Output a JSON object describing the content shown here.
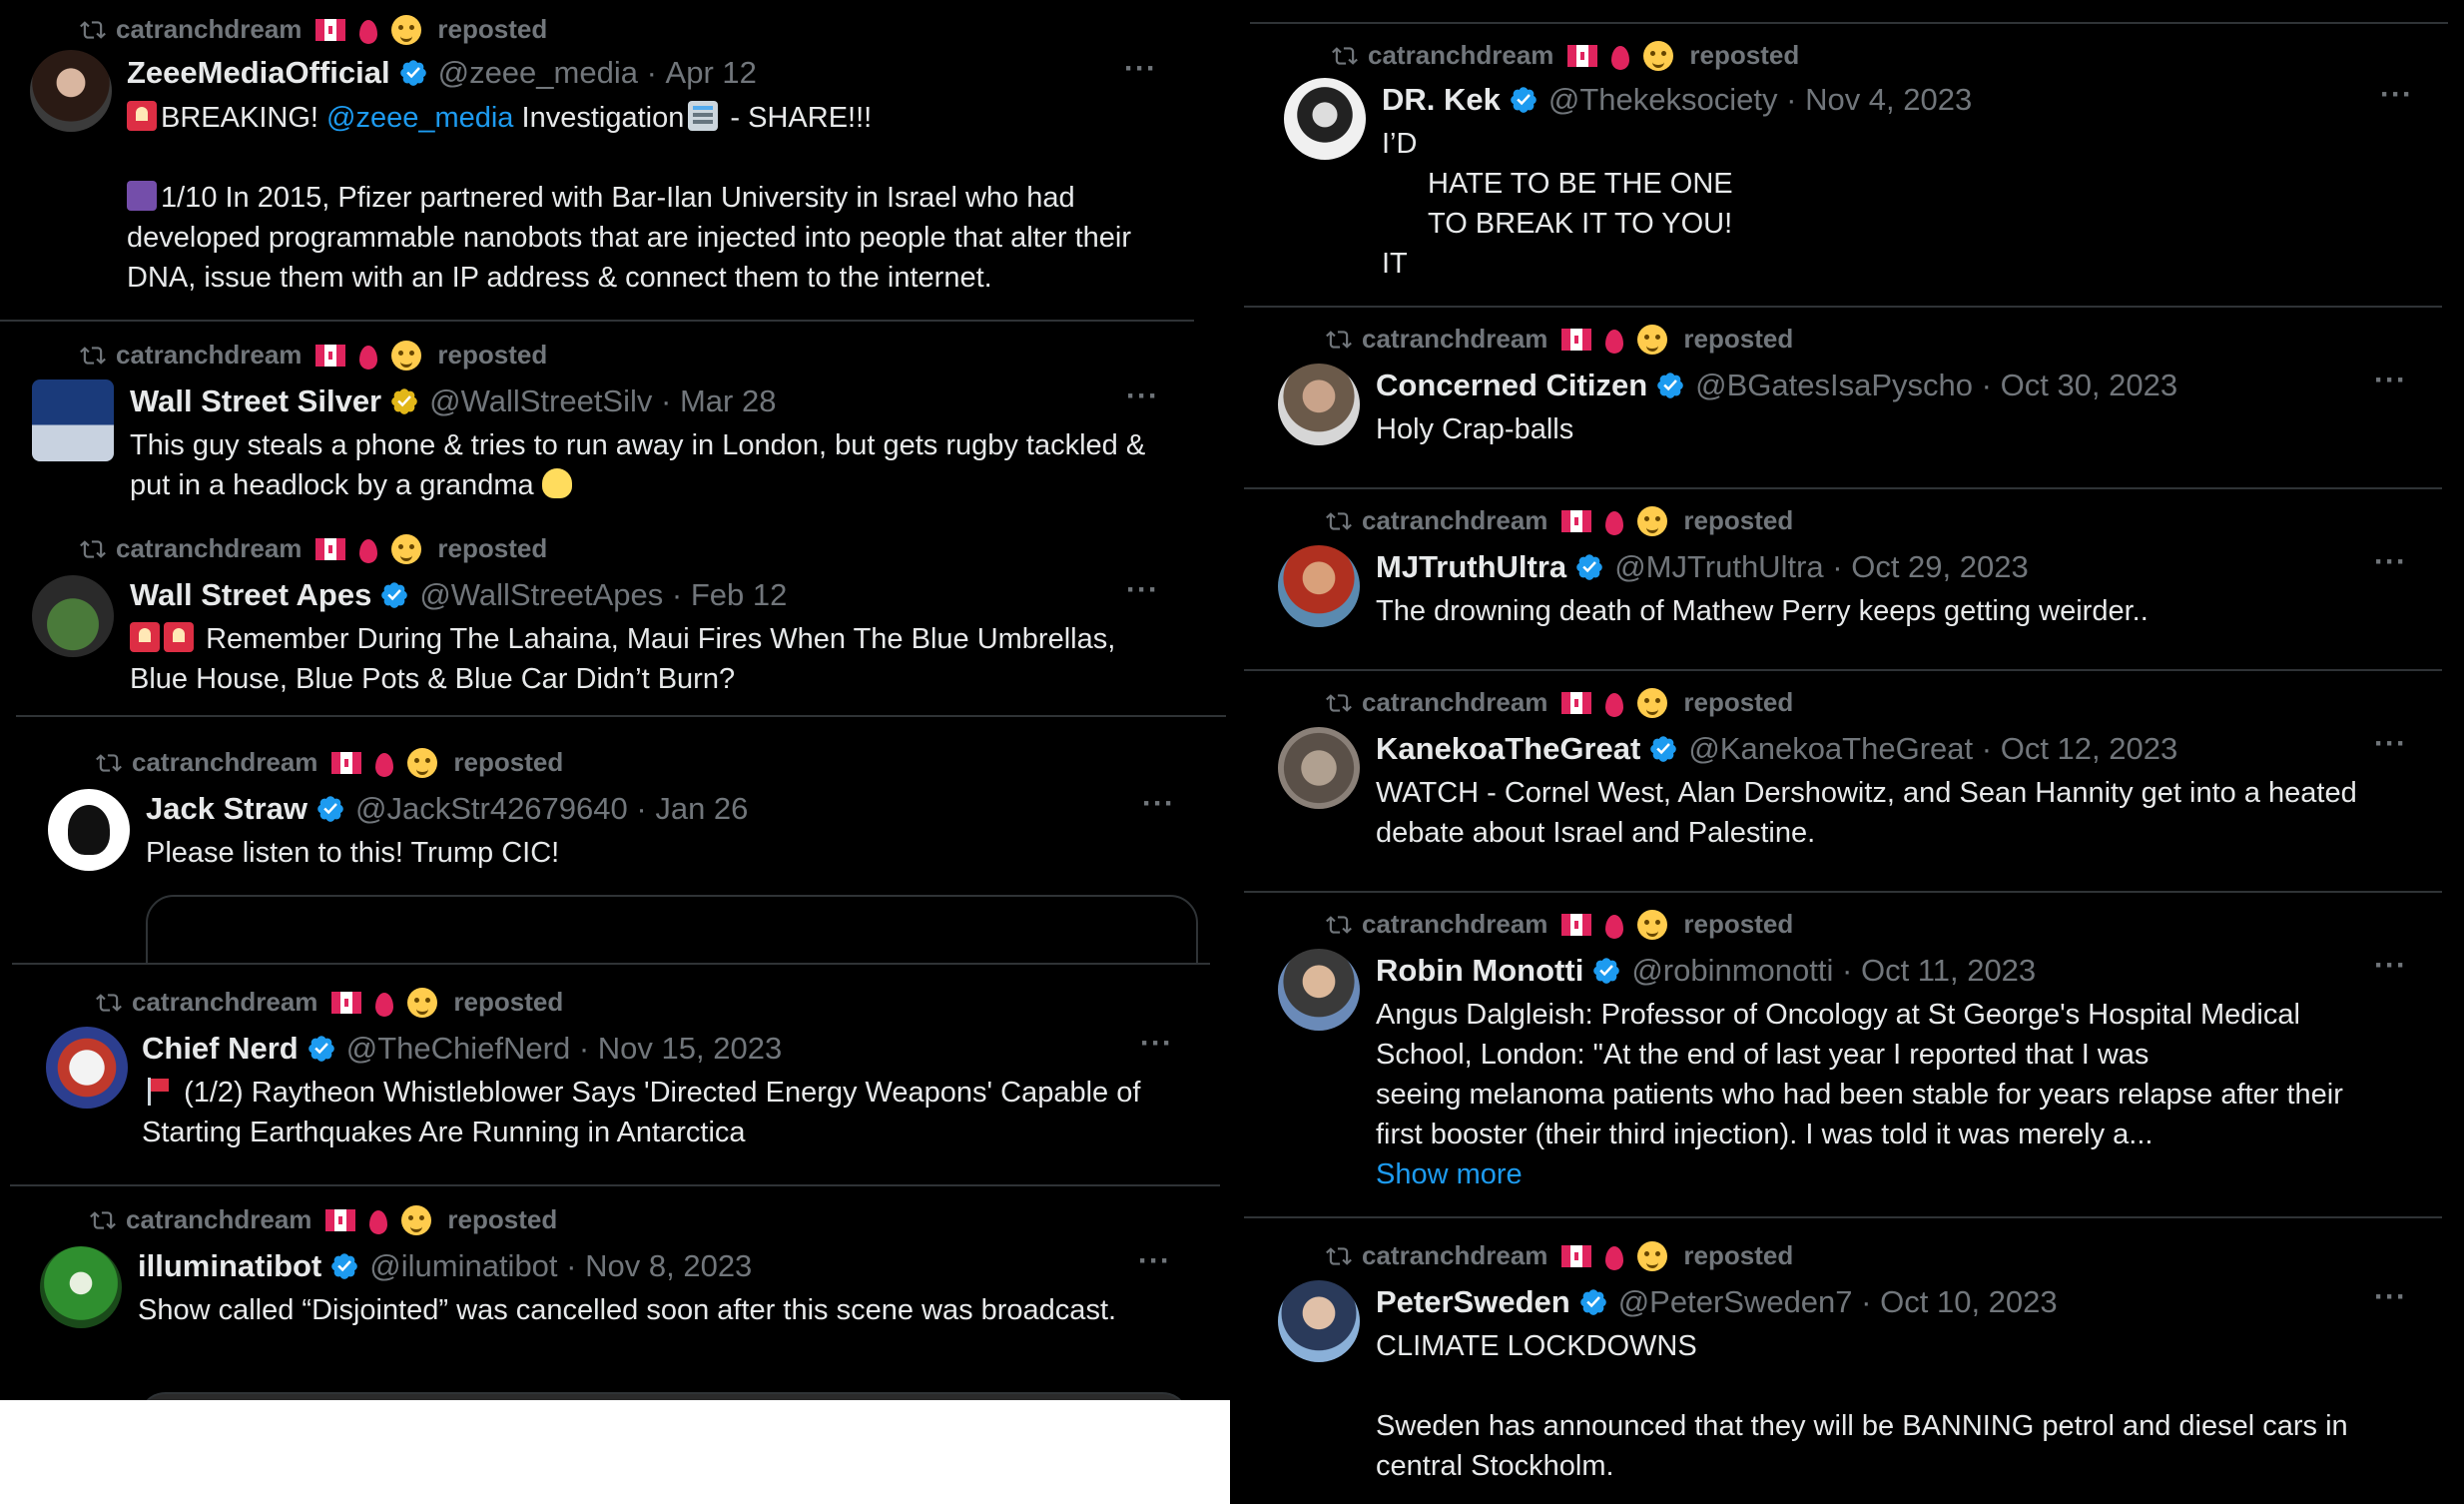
{
  "repost": {
    "user": "catranchdream",
    "label": "reposted"
  },
  "colors": {
    "bg": "#000000",
    "text": "#e7e9ea",
    "muted": "#71767b",
    "link": "#1d9bf0",
    "verified": "#1d9bf0",
    "gold": "#e2b719"
  },
  "tweets": [
    {
      "name": "ZeeeMediaOfficial",
      "handle": "@zeee_media",
      "dot": "·",
      "date": "Apr 12",
      "line1_pre": "BREAKING!",
      "line1_link": "@zeee_media",
      "line1_mid": "Investigation",
      "line1_post": "- SHARE!!!",
      "para2": "1/10 In 2015, Pfizer partnered with Bar-Ilan University in Israel who had developed programmable nanobots that are injected into people that alter their DNA, issue them with an IP address & connect them to the internet."
    },
    {
      "name": "Wall Street Silver",
      "handle": "@WallStreetSilv",
      "dot": "·",
      "date": "Mar 28",
      "text": "This guy steals a phone & tries to run away in London, but gets rugby tackled & put in a headlock by a grandma"
    },
    {
      "name": "Wall Street Apes",
      "handle": "@WallStreetApes",
      "dot": "·",
      "date": "Feb 12",
      "text": "Remember During The Lahaina, Maui Fires When The Blue Umbrellas, Blue House, Blue Pots & Blue Car Didn’t Burn?"
    },
    {
      "name": "Jack Straw",
      "handle": "@JackStr42679640",
      "dot": "·",
      "date": "Jan 26",
      "text": "Please listen to this! Trump CIC!"
    },
    {
      "name": "Chief Nerd",
      "handle": "@TheChiefNerd",
      "dot": "·",
      "date": "Nov 15, 2023",
      "text": "(1/2) Raytheon Whistleblower Says 'Directed Energy Weapons' Capable of Starting Earthquakes Are Running in Antarctica"
    },
    {
      "name": "illuminatibot",
      "handle": "@iluminatibot",
      "dot": "·",
      "date": "Nov 8, 2023",
      "text": "Show called “Disjointed” was cancelled soon after this scene was broadcast."
    },
    {
      "name": "DR. Kek",
      "handle": "@Thekeksociety",
      "dot": "·",
      "date": "Nov 4, 2023",
      "l1": "I’D",
      "l2": "HATE TO BE THE ONE",
      "l3": "TO BREAK IT TO YOU!",
      "l4": "IT"
    },
    {
      "name": "Concerned Citizen",
      "handle": "@BGatesIsaPyscho",
      "dot": "·",
      "date": "Oct 30, 2023",
      "text": "Holy Crap-balls"
    },
    {
      "name": "MJTruthUltra",
      "handle": "@MJTruthUltra",
      "dot": "·",
      "date": "Oct 29, 2023",
      "text": "The drowning death of Mathew Perry keeps getting weirder.."
    },
    {
      "name": "KanekoaTheGreat",
      "handle": "@KanekoaTheGreat",
      "dot": "·",
      "date": "Oct 12, 2023",
      "text": "WATCH - Cornel West, Alan Dershowitz, and Sean Hannity get into a heated debate about Israel and Palestine."
    },
    {
      "name": "Robin Monotti",
      "handle": "@robinmonotti",
      "dot": "·",
      "date": "Oct 11, 2023",
      "l1": "Angus Dalgleish: Professor of Oncology at St George's Hospital Medical",
      "l2": "School, London: \"At the end of last year I reported that I was",
      "l3": "seeing melanoma patients who had been stable for years relapse after their",
      "l4": "first booster (their third injection). I was told it was merely a...",
      "more": "Show more"
    },
    {
      "name": "PeterSweden",
      "handle": "@PeterSweden7",
      "dot": "·",
      "date": "Oct 10, 2023",
      "p1": "CLIMATE LOCKDOWNS",
      "p2": "Sweden has announced that they will be BANNING petrol and diesel cars in central Stockholm."
    }
  ],
  "more_glyph": "···",
  "icons": {
    "repost": "repost-icon",
    "verified": "verified-badge-icon",
    "more": "more-options-icon"
  }
}
